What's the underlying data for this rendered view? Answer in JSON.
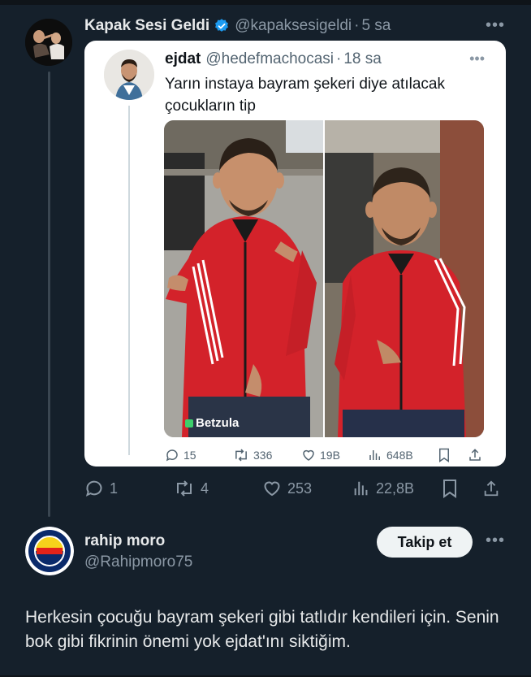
{
  "main_tweet": {
    "author_name": "Kapak Sesi Geldi",
    "handle": "@kapaksesigeldi",
    "time": "5 sa",
    "metrics": {
      "replies": "1",
      "retweets": "4",
      "likes": "253",
      "views": "22,8B"
    }
  },
  "quoted_tweet": {
    "author_name": "ejdat",
    "handle": "@hedefmachocasi",
    "time": "18 sa",
    "text": "Yarın instaya bayram şekeri diye atılacak çocukların tip",
    "media_watermark": "Betzula",
    "metrics": {
      "replies": "15",
      "retweets": "336",
      "likes": "19B",
      "views": "648B"
    }
  },
  "reply": {
    "author_name": "rahip moro",
    "handle": "@Rahipmoro75",
    "follow_label": "Takip et",
    "text": "Herkesin çocuğu bayram şekeri gibi tatlıdır kendileri için. Senin bok gibi fikrinin önemi yok ejdat'ını siktiğim."
  },
  "colors": {
    "background": "#15202b",
    "text_primary": "#e7e9ea",
    "text_secondary": "#8b98a5",
    "verified": "#1d9bf0",
    "jacket_red": "#d3222a"
  }
}
